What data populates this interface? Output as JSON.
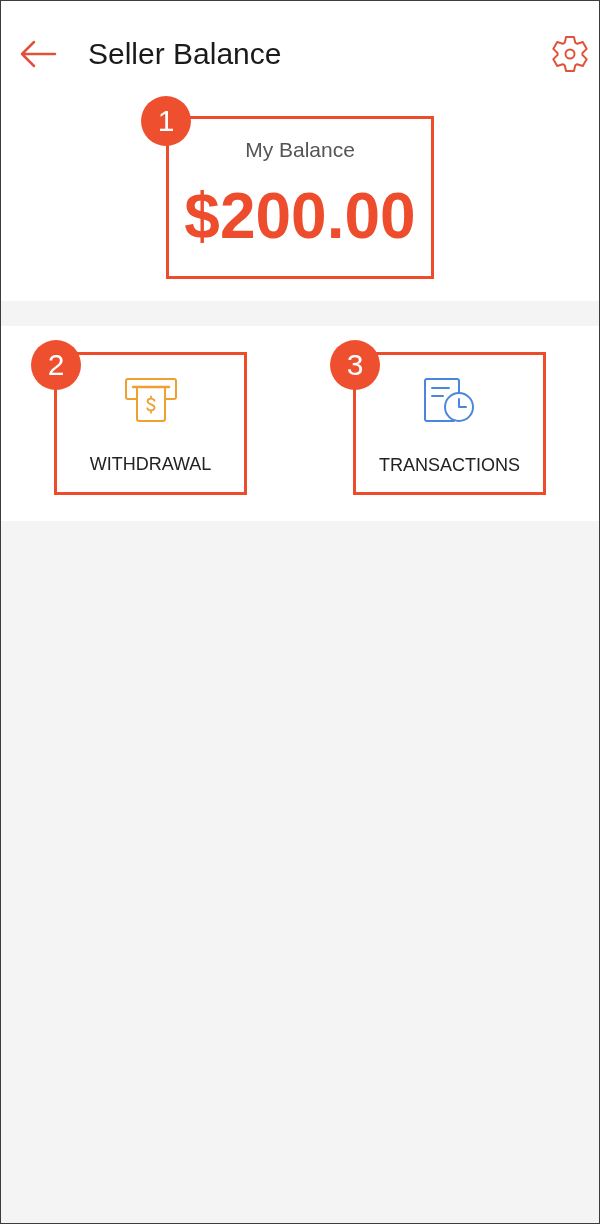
{
  "header": {
    "title": "Seller Balance"
  },
  "balance": {
    "label": "My Balance",
    "amount": "$200.00",
    "annotation": "1"
  },
  "actions": [
    {
      "kind": "withdrawal",
      "label": "WITHDRAWAL",
      "annotation": "2"
    },
    {
      "kind": "transactions",
      "label": "TRANSACTIONS",
      "annotation": "3"
    }
  ]
}
